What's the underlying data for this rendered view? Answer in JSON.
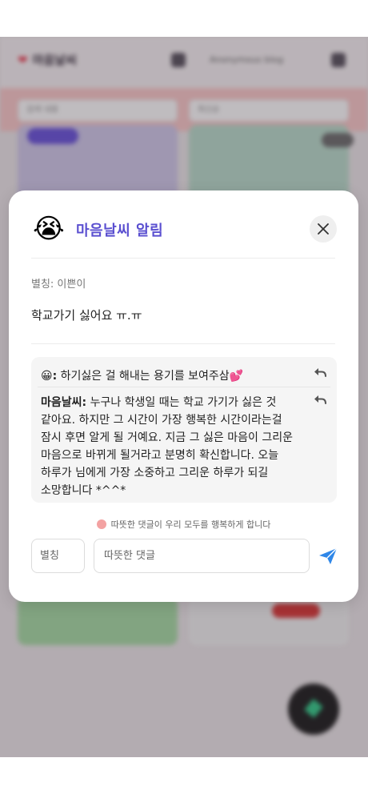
{
  "background_app": {
    "logo": "마음날씨",
    "search_text": "Anonymous blog",
    "search_placeholder": "검색 내용",
    "filter_label": "최신순"
  },
  "modal": {
    "title_emoji": "😭",
    "title": "마음날씨 알림",
    "nickname_line": "별칭: 이쁜이",
    "post_text": "학교가기 싫어요 ㅠ.ㅠ",
    "comments": [
      {
        "author_emoji": "😀",
        "author_suffix": ":",
        "text": "하기싫은 걸 해내는 용기를 보여주삼💕"
      },
      {
        "author": "마음날씨:",
        "text": "누구나 학생일 때는 학교 가기가 싫은 것 같아요. 하지만 그 시간이 가장 행복한 시간이라는걸 잠시 후면 알게 될 거예요. 지금 그 싫은 마음이 그리운 마음으로 바뀌게 될거라고 분명히 확신합니다. 오늘 하루가 님에게 가장 소중하고 그리운 하루가 되길 소망합니다 *^^*"
      }
    ],
    "footer_note": "따뜻한 댓글이 우리 모두를 행복하게 합니다",
    "nickname_placeholder": "별칭",
    "comment_placeholder": "따뜻한 댓글"
  },
  "colors": {
    "accent": "#5a4fd0",
    "send": "#2f87e8",
    "scrim": "rgba(40,30,40,0.28)"
  },
  "icons": {
    "close": "close-icon",
    "reply": "reply-icon",
    "send": "send-icon"
  }
}
